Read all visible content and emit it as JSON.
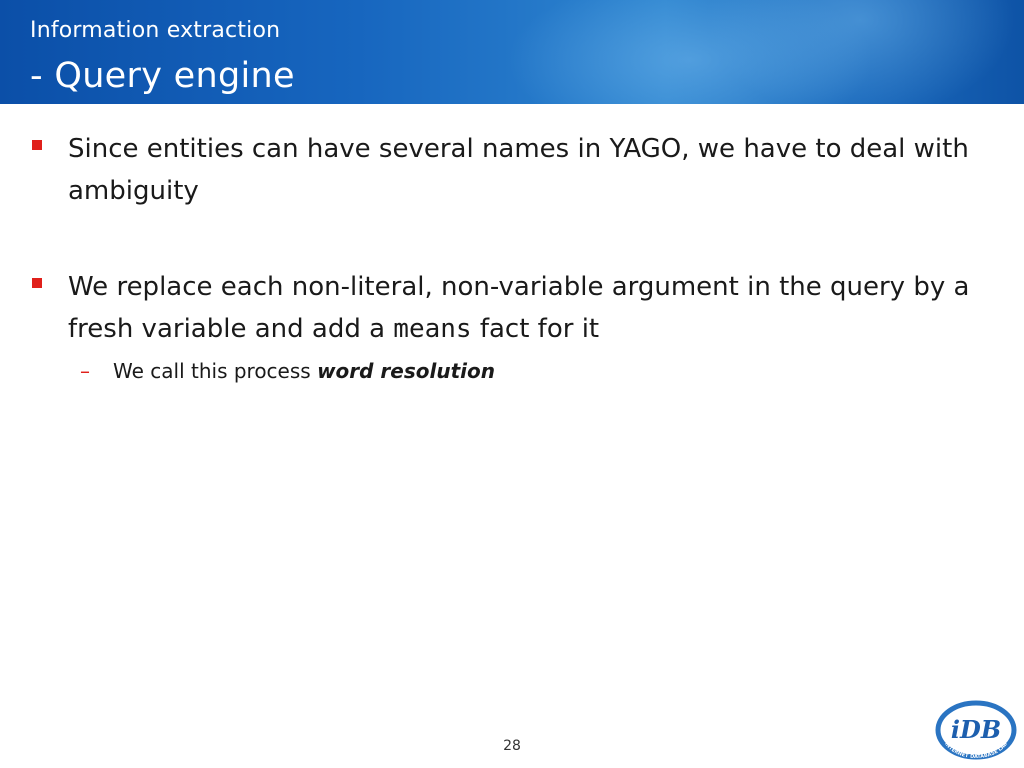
{
  "header": {
    "title_small": "Information extraction",
    "title_large": "- Query engine"
  },
  "bullets": [
    {
      "text": "Since entities can have several names in YAGO, we have to deal with ambiguity"
    },
    {
      "text_before": "We replace each non-literal, non-variable argument in the query by a fresh variable and add a ",
      "code": "means",
      "text_after": " fact for it",
      "sub": {
        "marker": "–",
        "text_before": "We call this process ",
        "emphasis": "word resolution"
      }
    }
  ],
  "footer": {
    "page_number": "28"
  },
  "logo": {
    "text": "iDB",
    "ring_text": "INTERNET DATABASE LAB",
    "colors": {
      "primary": "#1d5fae",
      "ring": "#2a74c2"
    }
  },
  "colors": {
    "header_primary": "#1766bf",
    "bullet_marker": "#e0201b",
    "text": "#1a1a1a"
  }
}
